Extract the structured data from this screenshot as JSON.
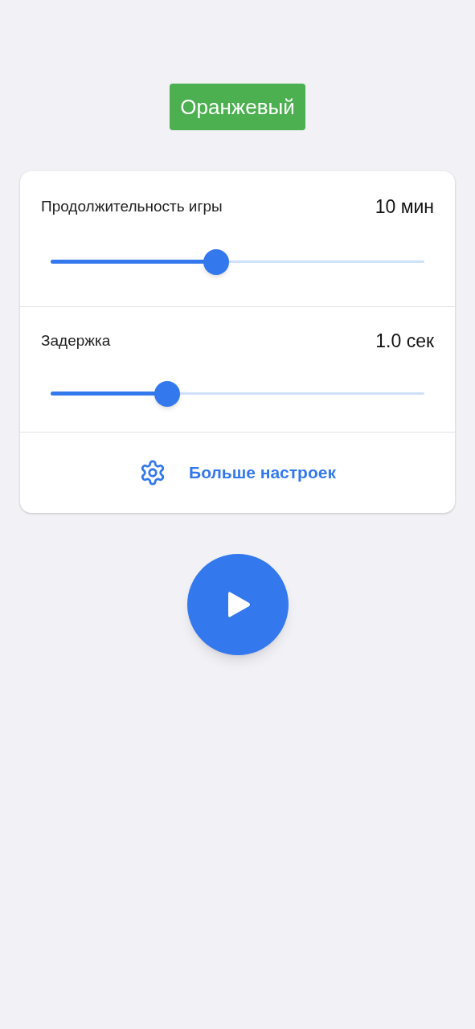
{
  "badge": {
    "label": "Оранжевый"
  },
  "settings": [
    {
      "label": "Продолжительность игры",
      "reading": "10 мин",
      "level": 0.443
    },
    {
      "label": "Задержка",
      "reading": "1.0 сек",
      "level": 0.312
    }
  ],
  "more_settings": {
    "label": "Больше настроек"
  }
}
